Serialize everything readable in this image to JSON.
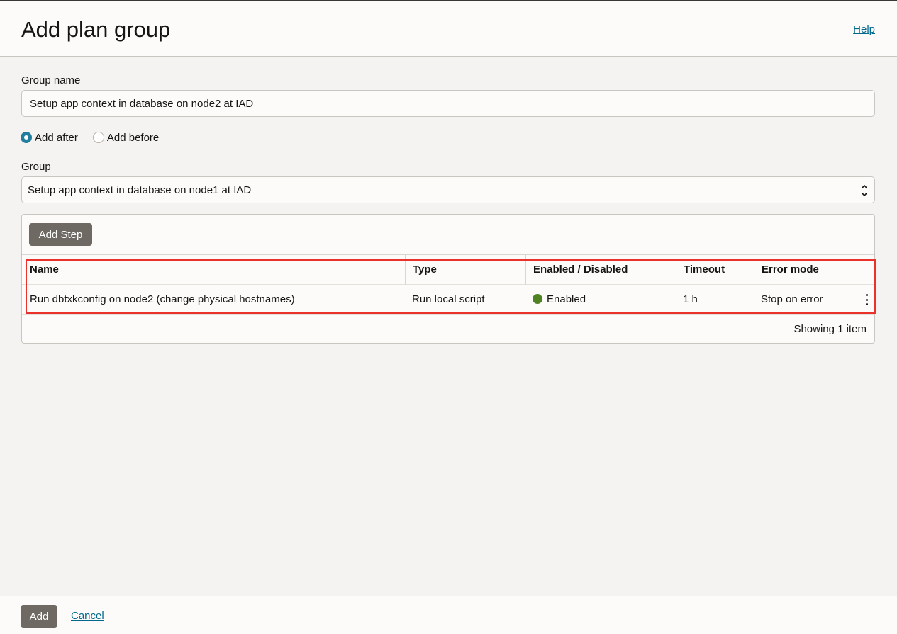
{
  "header": {
    "title": "Add plan group",
    "help_link": "Help"
  },
  "form": {
    "group_name_label": "Group name",
    "group_name_value": "Setup app context in database on node2 at IAD",
    "position_options": [
      {
        "label": "Add after",
        "selected": true
      },
      {
        "label": "Add before",
        "selected": false
      }
    ],
    "group_label": "Group",
    "group_selected": "Setup app context in database on node1 at IAD"
  },
  "steps": {
    "add_step_label": "Add Step",
    "columns": [
      "Name",
      "Type",
      "Enabled / Disabled",
      "Timeout",
      "Error mode"
    ],
    "rows": [
      {
        "name": "Run dbtxkconfig on node2 (change physical hostnames)",
        "type": "Run local script",
        "status": "Enabled",
        "timeout": "1 h",
        "error_mode": "Stop on error"
      }
    ],
    "status_color": "#508223",
    "showing": "Showing 1 item"
  },
  "footer": {
    "add_label": "Add",
    "cancel_label": "Cancel"
  },
  "colors": {
    "highlight": "#e8322b",
    "link": "#00688c",
    "radio_selected": "#227e9e",
    "button_dark": "#6f6964"
  }
}
